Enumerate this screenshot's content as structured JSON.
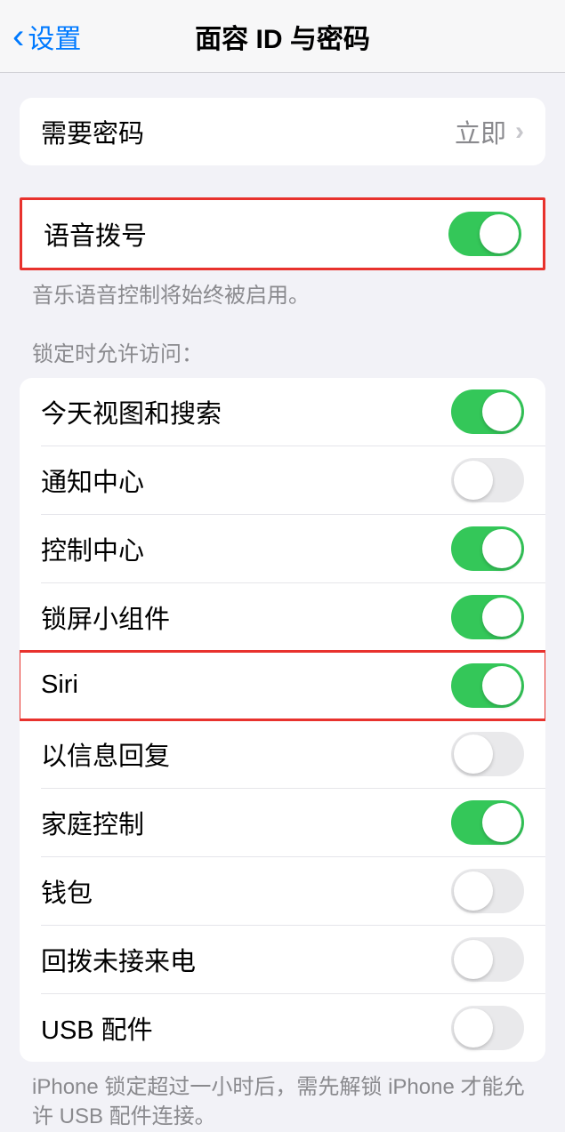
{
  "header": {
    "back_label": "设置",
    "title": "面容 ID 与密码"
  },
  "require_passcode": {
    "label": "需要密码",
    "value": "立即"
  },
  "voice_dial": {
    "label": "语音拨号",
    "enabled": true,
    "footer": "音乐语音控制将始终被启用。"
  },
  "lock_section": {
    "header": "锁定时允许访问：",
    "items": [
      {
        "label": "今天视图和搜索",
        "enabled": true
      },
      {
        "label": "通知中心",
        "enabled": false
      },
      {
        "label": "控制中心",
        "enabled": true
      },
      {
        "label": "锁屏小组件",
        "enabled": true
      },
      {
        "label": "Siri",
        "enabled": true
      },
      {
        "label": "以信息回复",
        "enabled": false
      },
      {
        "label": "家庭控制",
        "enabled": true
      },
      {
        "label": "钱包",
        "enabled": false
      },
      {
        "label": "回拨未接来电",
        "enabled": false
      },
      {
        "label": "USB 配件",
        "enabled": false
      }
    ],
    "footer": "iPhone 锁定超过一小时后，需先解锁 iPhone 才能允许 USB 配件连接。"
  },
  "highlights": {
    "voice_dial": true,
    "siri_index": 4
  }
}
